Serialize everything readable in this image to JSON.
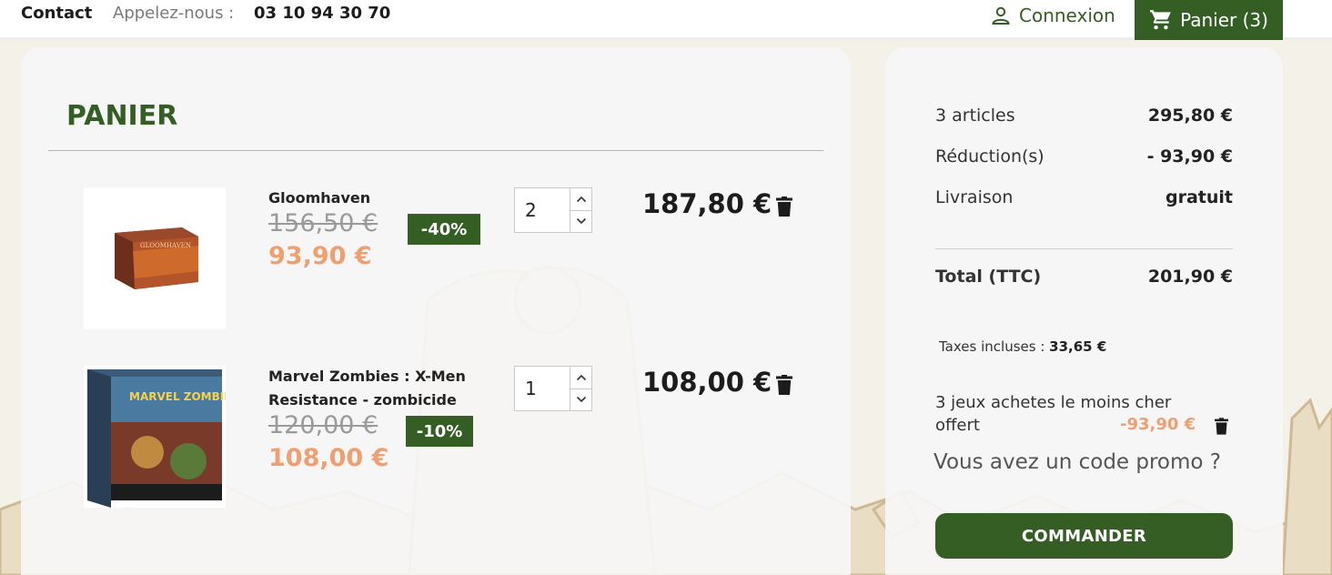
{
  "header": {
    "contact_label": "Contact",
    "call_label": "Appelez-nous :",
    "phone": "03 10 94 30 70",
    "login_label": "Connexion",
    "cart_label": "Panier (3)"
  },
  "cart": {
    "title": "PANIER",
    "items": [
      {
        "name_lines": [
          "Gloomhaven"
        ],
        "old_price": "156,50 €",
        "new_price": "93,90 €",
        "discount": "-40%",
        "quantity": "2",
        "line_total": "187,80 €",
        "image_text": "GLOOMHAVEN"
      },
      {
        "name_lines": [
          "Marvel Zombies : X-Men",
          "Resistance - zombicide"
        ],
        "old_price": "120,00 €",
        "new_price": "108,00 €",
        "discount": "-10%",
        "quantity": "1",
        "line_total": "108,00 €",
        "image_text": "MARVEL ZOMBIES"
      }
    ]
  },
  "summary": {
    "articles_label": "3 articles",
    "articles_value": "295,80 €",
    "discount_label": "Réduction(s)",
    "discount_value": "- 93,90 €",
    "shipping_label": "Livraison",
    "shipping_value": "gratuit",
    "total_label": "Total (TTC)",
    "total_value": "201,90 €",
    "tax_label": "Taxes incluses :",
    "tax_value": "33,65 €",
    "offer_label": "3 jeux achetes le moins cher offert",
    "offer_value": "-93,90 €",
    "promo_label": "Vous avez un code promo ?",
    "checkout_label": "COMMANDER"
  },
  "colors": {
    "brand_green": "#355e24",
    "price_orange": "#f0a070"
  },
  "icons": [
    "user-icon",
    "cart-icon",
    "trash-icon",
    "chevron-up-icon",
    "chevron-down-icon"
  ]
}
